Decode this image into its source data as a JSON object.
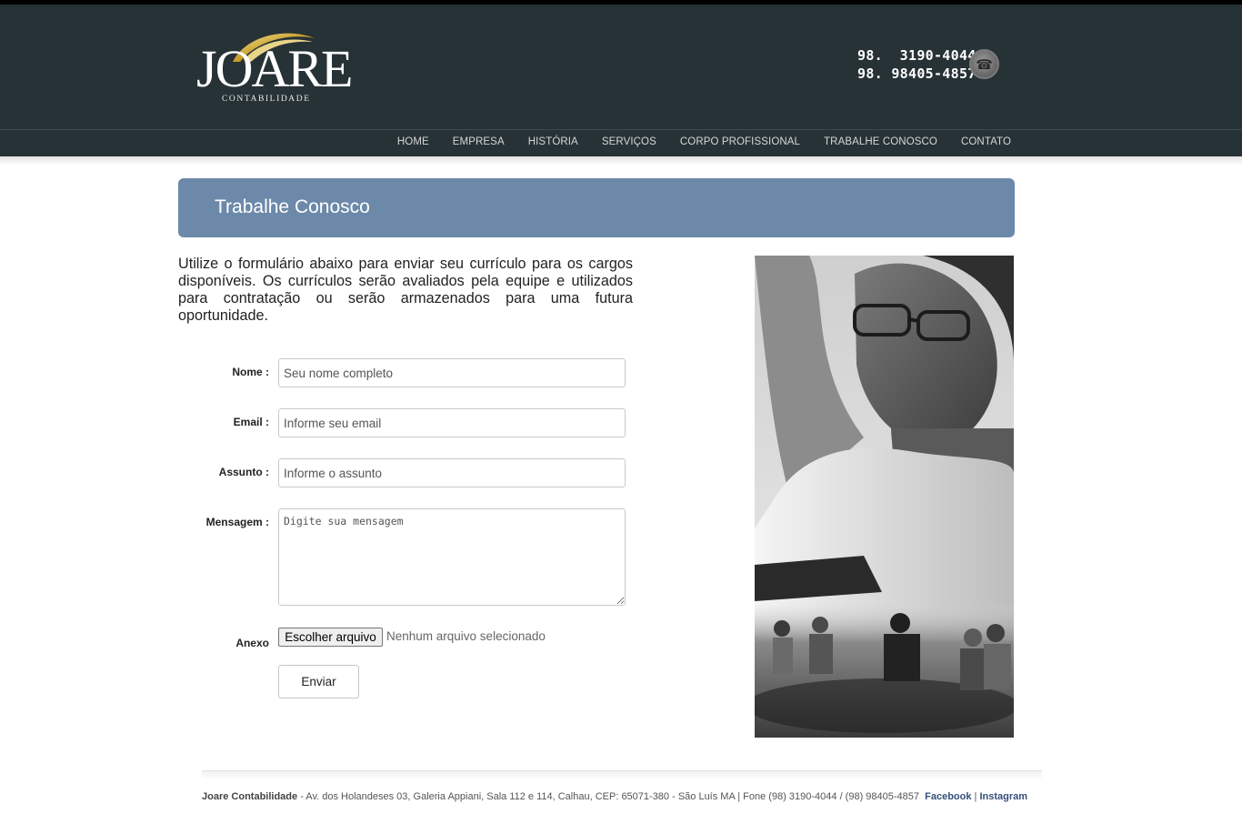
{
  "brand": {
    "logo_text": "JOARE",
    "logo_sub": "CONTABILIDADE"
  },
  "contact": {
    "phone1": "98.  3190-4044",
    "phone2": "98. 98405-4857"
  },
  "nav": {
    "items": [
      "HOME",
      "EMPRESA",
      "HISTÓRIA",
      "SERVIÇOS",
      "CORPO PROFISSIONAL",
      "TRABALHE CONOSCO",
      "CONTATO"
    ]
  },
  "page": {
    "title": "Trabalhe Conosco",
    "intro": "Utilize o formulário abaixo para enviar seu currículo para os cargos disponíveis. Os currículos serão avaliados pela equipe e utilizados para contratação ou serão armazenados para uma futura oportunidade."
  },
  "form": {
    "name_label": "Nome :",
    "name_placeholder": "Seu nome completo",
    "email_label": "Email :",
    "email_placeholder": "Informe seu email",
    "subject_label": "Assunto :",
    "subject_placeholder": "Informe o assunto",
    "message_label": "Mensagem :",
    "message_placeholder": "Digite sua mensagem",
    "attachment_label": "Anexo",
    "file_button": "Escolher arquivo",
    "file_status": "Nenhum arquivo selecionado",
    "submit": "Enviar"
  },
  "footer": {
    "company": "Joare Contabilidade",
    "address": " - Av. dos Holandeses 03, Galeria Appiani, Sala 112 e 114, Calhau, CEP: 65071-380 - São Luís MA | Fone (98) 3190-4044 / (98) 98405-4857  ",
    "facebook": "Facebook",
    "separator": " | ",
    "instagram": "Instagram"
  },
  "colors": {
    "header_bg": "#273236",
    "banner_bg": "#6c89a9",
    "logo_gold": "#d4b13a"
  },
  "icons": {
    "phone": "phone-icon"
  }
}
